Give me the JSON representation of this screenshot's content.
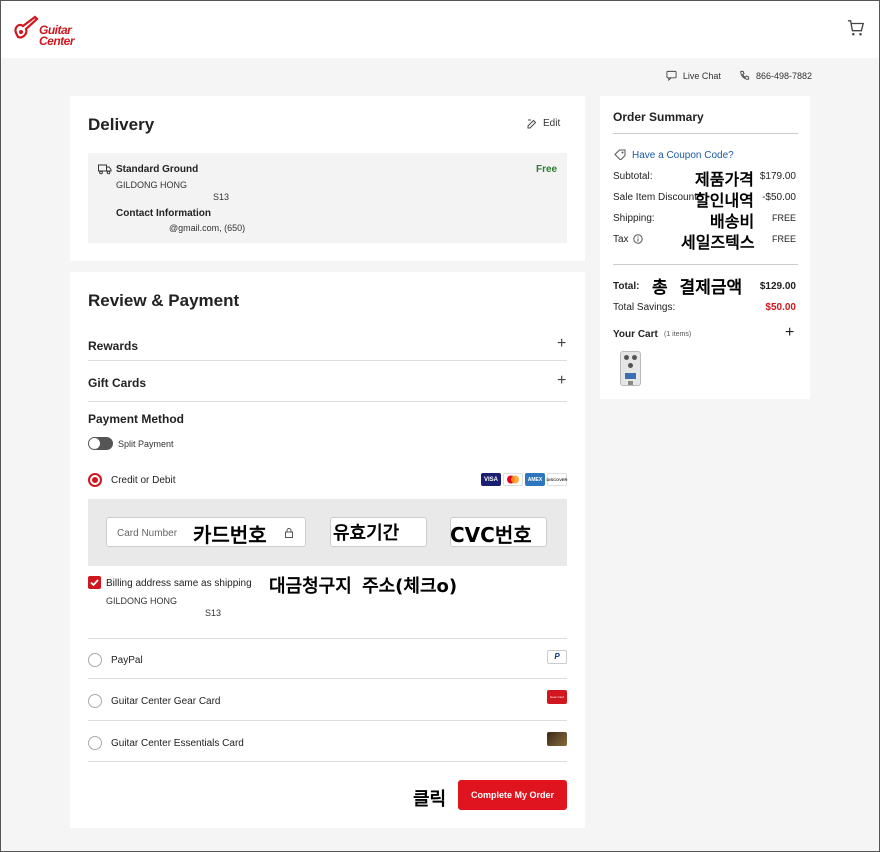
{
  "header": {
    "logo_text_line1": "Guitar",
    "logo_text_line2": "Center",
    "cart_icon": "cart-icon"
  },
  "topbar": {
    "live_chat": "Live Chat",
    "phone": "866-498-7882"
  },
  "delivery": {
    "title": "Delivery",
    "edit": "Edit",
    "method": "Standard Ground",
    "price": "Free",
    "name": "GILDONG HONG",
    "address_fragment": "S13",
    "contact_title": "Contact Information",
    "contact_value": "@gmail.com, (650)"
  },
  "review": {
    "title": "Review & Payment",
    "rewards": "Rewards",
    "gift_cards": "Gift Cards",
    "payment_method": "Payment Method",
    "split_payment": "Split Payment",
    "credit_or_debit": "Credit or Debit",
    "card_number_placeholder": "Card Number",
    "billing_same": "Billing address same as shipping",
    "billing_name": "GILDONG HONG",
    "billing_address": "S13",
    "paypal": "PayPal",
    "gear_card": "Guitar Center Gear Card",
    "essentials_card": "Guitar Center Essentials Card",
    "complete_order": "Complete My Order",
    "card_brands": [
      "VISA",
      "MC",
      "AMEX",
      "DISCOVER"
    ],
    "paypal_logo": "P",
    "gear_card_logo": "Gear Card"
  },
  "summary": {
    "title": "Order Summary",
    "coupon": "Have a Coupon Code?",
    "subtotal_label": "Subtotal:",
    "subtotal_value": "$179.00",
    "sale_label": "Sale Item Discount",
    "sale_value": "-$50.00",
    "shipping_label": "Shipping:",
    "shipping_value": "FREE",
    "tax_label": "Tax",
    "tax_value": "FREE",
    "total_label": "Total:",
    "total_value": "$129.00",
    "savings_label": "Total Savings:",
    "savings_value": "$50.00",
    "cart_label": "Your Cart",
    "cart_count": "(1 items)"
  },
  "annotations": {
    "product_price": "제품가격",
    "discount": "할인내역",
    "shipping": "배송비",
    "sales_tax": "세일즈텍스",
    "total": "총 결제금액",
    "card_number": "카드번호",
    "expiry": "유효기간",
    "cvc": "CVC번호",
    "billing": "대금청구지 주소(체크o)",
    "click": "클릭"
  },
  "colors": {
    "brand_red": "#d0161e",
    "free_green": "#2e7d32",
    "coupon_blue": "#1a5aa8"
  }
}
